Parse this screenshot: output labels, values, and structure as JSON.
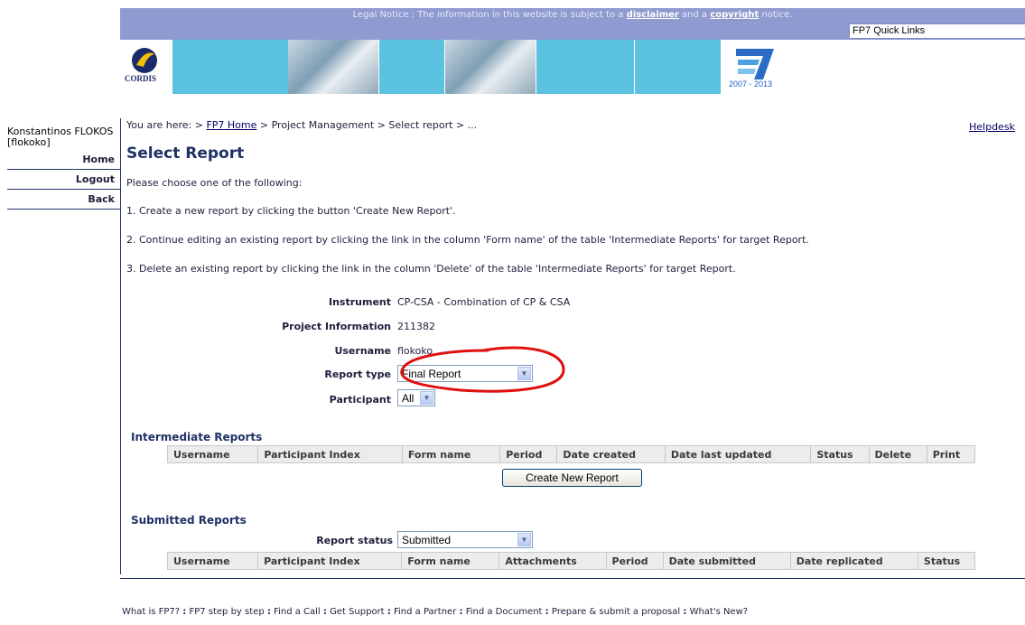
{
  "legal": {
    "prefix": "Legal Notice : The information in this website is subject to a ",
    "disclaimer": "disclaimer",
    "middle": " and a ",
    "copyright": "copyright",
    "suffix": " notice."
  },
  "quick_links": "FP7 Quick Links",
  "banner": {
    "cordis": "CORDIS",
    "fp7_years": "2007 - 2013"
  },
  "user": {
    "name": "Konstantinos FLOKOS [flokoko]"
  },
  "sidebar": {
    "home": "Home",
    "logout": "Logout",
    "back": "Back"
  },
  "breadcrumb": {
    "prefix": "You are here: > ",
    "home": "FP7 Home",
    "rest": " > Project Management > Select report > ..."
  },
  "helpdesk": "Helpdesk",
  "page_title": "Select Report",
  "intro": "Please choose one of the following:",
  "steps": [
    "1. Create a new report by clicking the button 'Create New Report'.",
    "2. Continue editing an existing report by clicking the link in the column 'Form name' of the table 'Intermediate Reports' for target Report.",
    "3. Delete an existing report by clicking the link in the column 'Delete' of the table 'Intermediate Reports' for target Report."
  ],
  "form": {
    "instrument_label": "Instrument",
    "instrument_value": "CP-CSA - Combination of CP & CSA",
    "project_label": "Project Information",
    "project_value": "211382",
    "username_label": "Username",
    "username_value": "flokoko",
    "report_type_label": "Report type",
    "report_type_value": "Final Report",
    "participant_label": "Participant",
    "participant_value": "All"
  },
  "intermediate": {
    "title": "Intermediate Reports",
    "columns": [
      "Username",
      "Participant Index",
      "Form name",
      "Period",
      "Date created",
      "Date last updated",
      "Status",
      "Delete",
      "Print"
    ],
    "create_button": "Create New Report"
  },
  "submitted": {
    "title": "Submitted Reports",
    "status_label": "Report status",
    "status_value": "Submitted",
    "columns": [
      "Username",
      "Participant Index",
      "Form name",
      "Attachments",
      "Period",
      "Date submitted",
      "Date replicated",
      "Status"
    ]
  },
  "footer": [
    "What is FP7?",
    "FP7 step by step",
    "Find a Call",
    "Get Support",
    "Find a Partner",
    "Find a Document",
    "Prepare & submit a proposal",
    "What's New?"
  ],
  "colors": {
    "header_blue": "#8e9ad0",
    "tile_cyan": "#5bc3df",
    "annotation_red": "#e01010"
  }
}
